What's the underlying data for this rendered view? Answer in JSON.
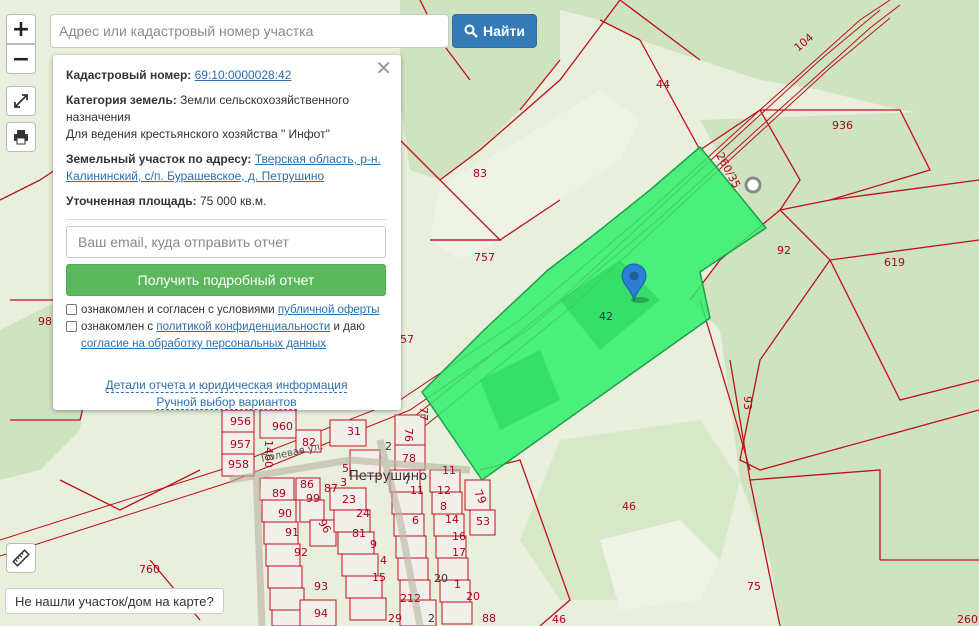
{
  "map": {
    "parcel_numbers": {
      "p44": "44",
      "p104": "104",
      "p936": "936",
      "p260_35": "260/35",
      "p83": "83",
      "p757": "757",
      "p92a": "92",
      "p619": "619",
      "p42": "42",
      "p98": "98",
      "p57": "57",
      "p93": "93",
      "p46a": "46",
      "p46b": "46",
      "p760": "760",
      "p75": "75",
      "p260": "260",
      "p956": "956",
      "p960": "960",
      "p82": "82",
      "p31": "31",
      "p76": "76",
      "p77": "77",
      "p957": "957",
      "p1460": "1460",
      "p958": "958",
      "p2": "2",
      "p78": "78",
      "p7": "7",
      "p11a": "11",
      "p11b": "11",
      "p79": "79",
      "p89": "89",
      "p86": "86",
      "p99": "99",
      "p23": "23",
      "p87": "87",
      "p12": "12",
      "p90": "90",
      "p96": "96",
      "p24": "24",
      "p14": "14",
      "p53": "53",
      "p91": "91",
      "p81": "81",
      "p6": "6",
      "p16": "16",
      "p92b": "92",
      "p9": "9",
      "p17": "17",
      "p4": "4",
      "p93b": "93",
      "p15": "15",
      "p20a": "20",
      "p1": "1",
      "p94": "94",
      "p212": "212",
      "p20b": "20",
      "p29": "29",
      "p88": "88",
      "p8": "8",
      "p5": "5",
      "p3": "3",
      "p2b": "2"
    },
    "street_label": "Полевая ул.",
    "village_label": "Петрушино",
    "highlight_color": "#33ee66",
    "boundary_color": "#c0101c",
    "marker_color": "#2a7fd4"
  },
  "controls": {
    "zoom_in": "+",
    "zoom_out": "−",
    "fullscreen_icon": "fullscreen-icon",
    "print_icon": "printer-icon",
    "ruler_icon": "ruler-icon"
  },
  "search": {
    "placeholder": "Адрес или кадастровый номер участка",
    "button_label": "Найти",
    "button_icon": "search-icon"
  },
  "panel": {
    "cadastral_label": "Кадастровый номер:",
    "cadastral_value": "69:10:0000028:42",
    "category_label": "Категория земель:",
    "category_value": "Земли сельскохозяйственного назначения",
    "usage": "Для ведения крестьянского хозяйства \" Инфот\"",
    "address_label": "Земельный участок по адресу:",
    "address_value": "Тверская область, р-н. Калининский, с/п. Бурашевское, д. Петрушино",
    "area_label": "Уточненная площадь:",
    "area_value": "75 000 кв.м.",
    "email_placeholder": "Ваш email, куда отправить отчет",
    "report_button": "Получить подробный отчет",
    "consent1_text": "ознакомлен и согласен с условиями",
    "consent1_link": "публичной оферты",
    "consent2_text": "ознакомлен с",
    "consent2_link": "политикой конфиденциальности",
    "consent2_mid": "и даю",
    "consent2_link2": "согласие на обработку персональных данных",
    "details_link": "Детали отчета и юридическая информация",
    "manual_link": "Ручной выбор вариантов",
    "close_icon": "close-icon"
  },
  "footer": {
    "not_found": "Не нашли участок/дом на карте?"
  }
}
